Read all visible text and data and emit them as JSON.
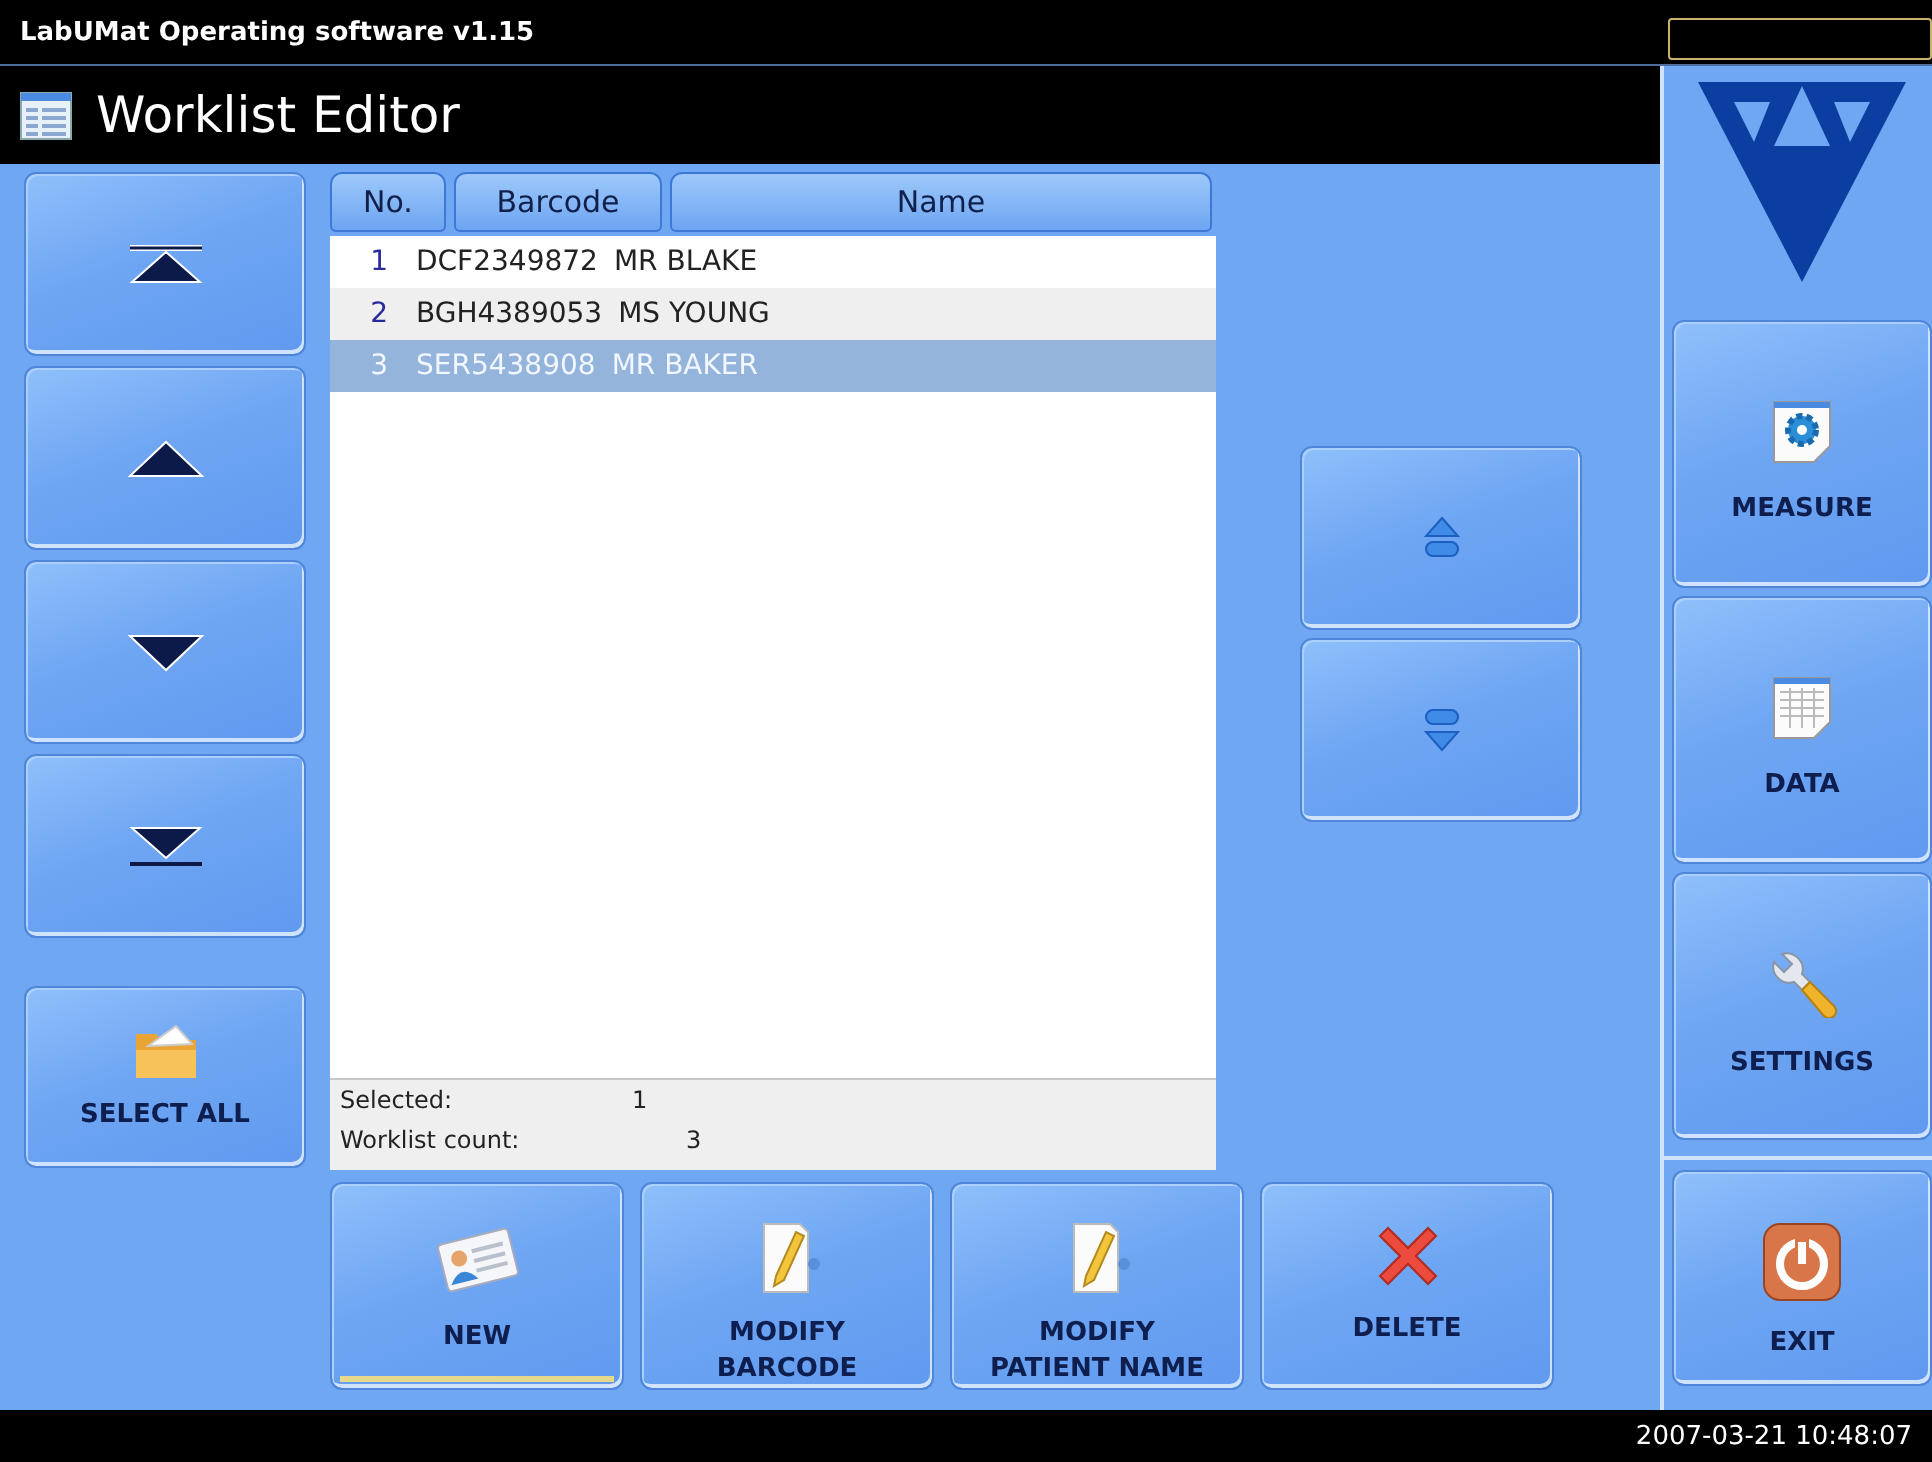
{
  "app_title": "LabUMat Operating software v1.15",
  "window": {
    "title": "Worklist Editor"
  },
  "scroll_buttons": [
    {
      "kind": "top"
    },
    {
      "kind": "up"
    },
    {
      "kind": "down"
    },
    {
      "kind": "bottom"
    }
  ],
  "select_all": {
    "label": "SELECT ALL"
  },
  "table": {
    "columns": [
      "No.",
      "Barcode",
      "Name"
    ],
    "rows": [
      {
        "no": "1",
        "barcode": "DCF2349872",
        "name": "MR BLAKE",
        "selected": false
      },
      {
        "no": "2",
        "barcode": "BGH4389053",
        "name": "MS YOUNG",
        "selected": false
      },
      {
        "no": "3",
        "barcode": "SER5438908",
        "name": "MR BAKER",
        "selected": true
      }
    ],
    "footer": {
      "selected_label": "Selected:",
      "selected_value": "1",
      "count_label": "Worklist count:",
      "count_value": "3"
    }
  },
  "move_buttons": [
    {
      "kind": "up"
    },
    {
      "kind": "down"
    }
  ],
  "actions": [
    {
      "kind": "new",
      "label": "NEW",
      "active": true
    },
    {
      "kind": "edit",
      "label": "MODIFY\nBARCODE",
      "active": false
    },
    {
      "kind": "edit",
      "label": "MODIFY\nPATIENT NAME",
      "active": false
    },
    {
      "kind": "delete",
      "label": "DELETE",
      "active": false
    }
  ],
  "sidebar": {
    "items": [
      {
        "kind": "measure",
        "label": "MEASURE"
      },
      {
        "kind": "data",
        "label": "DATA"
      },
      {
        "kind": "settings",
        "label": "SETTINGS"
      }
    ],
    "exit": {
      "label": "EXIT"
    }
  },
  "status_bar": {
    "datetime": "2007-03-21 10:48:07"
  }
}
